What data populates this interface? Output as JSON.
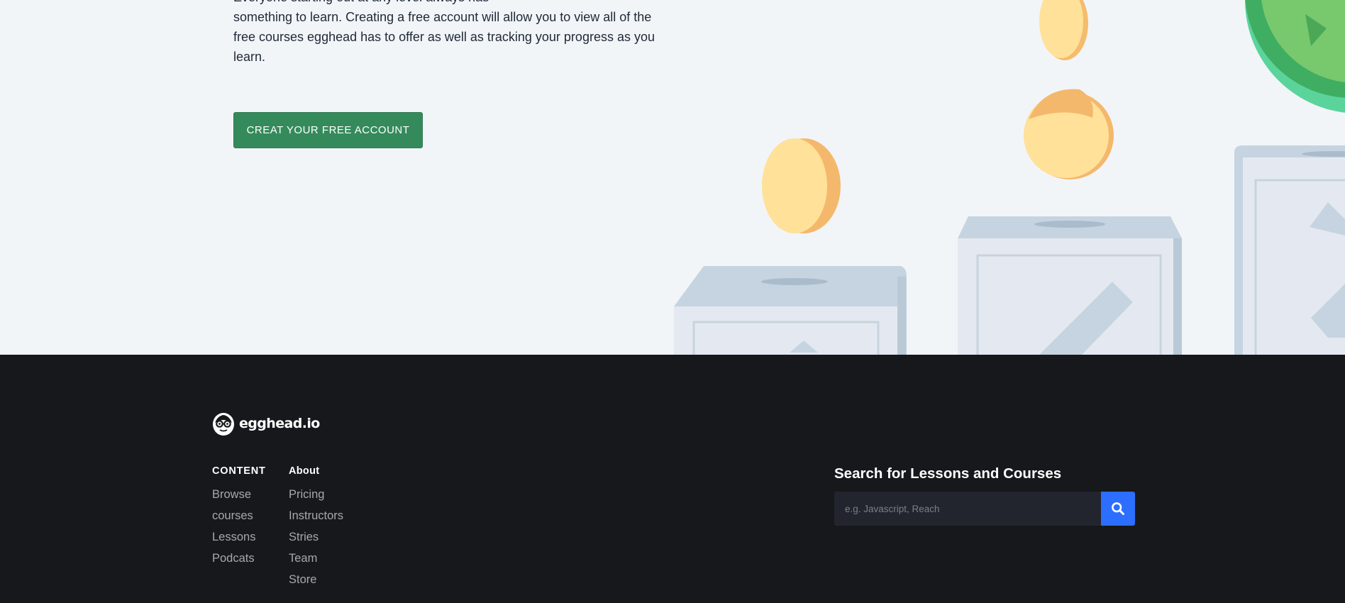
{
  "hero": {
    "text_lines": [
      "Everyone starting out at any level always has",
      "something to learn. Creating a free account will allow you to view all of the",
      "free courses egghead has to offer as well as tracking your progress as you",
      "learn."
    ],
    "cta_label": "CREAT YOUR FREE ACCOUNT",
    "cta_color": "#358a5b"
  },
  "footer": {
    "logo_text": "egghead.io",
    "content": {
      "heading": "CONTENT",
      "links": [
        "Browse",
        "courses",
        "Lessons",
        "Podcats"
      ]
    },
    "about": {
      "heading": "About",
      "links": [
        "Pricing",
        "Instructors",
        "Stries",
        "Team",
        "Store"
      ]
    },
    "search": {
      "title": "Search for Lessons and Courses",
      "placeholder": "e.g. Javascript, Reach",
      "button_icon": "search-icon",
      "button_color": "#2c6eff"
    },
    "background": "#17181b"
  }
}
